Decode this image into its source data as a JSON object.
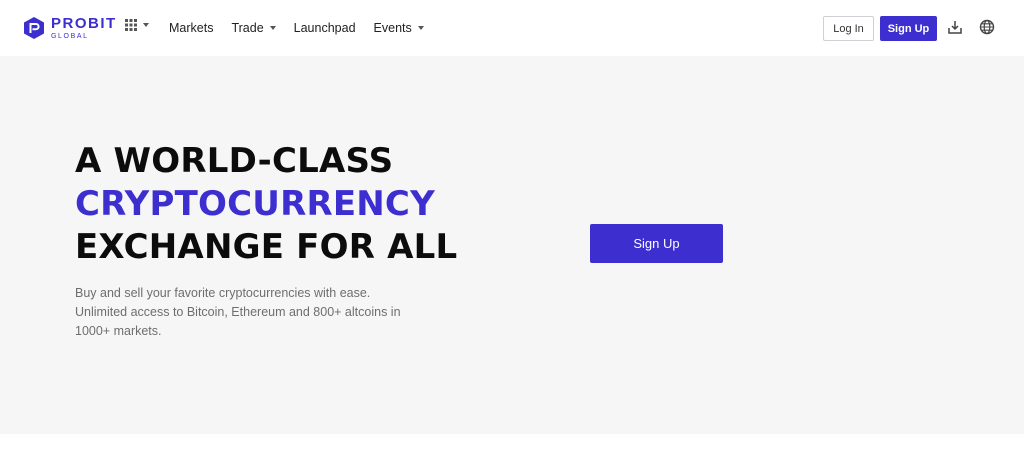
{
  "brand": {
    "name": "PROBIT",
    "sub": "GLOBAL",
    "color": "#3d2ed0"
  },
  "header": {
    "apps_icon": "grid-icon",
    "nav": [
      {
        "label": "Markets",
        "dropdown": false
      },
      {
        "label": "Trade",
        "dropdown": true
      },
      {
        "label": "Launchpad",
        "dropdown": false
      },
      {
        "label": "Events",
        "dropdown": true
      }
    ],
    "login_label": "Log In",
    "signup_label": "Sign Up",
    "download_icon": "download-icon",
    "language_icon": "globe-icon"
  },
  "hero": {
    "line1": "A WORLD-CLASS",
    "line2": "CRYPTOCURRENCY",
    "line3": "EXCHANGE FOR ALL",
    "subtitle": "Buy and sell your favorite cryptocurrencies with ease. Unlimited access to Bitcoin, Ethereum and 800+ altcoins in 1000+ markets.",
    "cta_label": "Sign Up",
    "background": "#f6f6f6"
  }
}
